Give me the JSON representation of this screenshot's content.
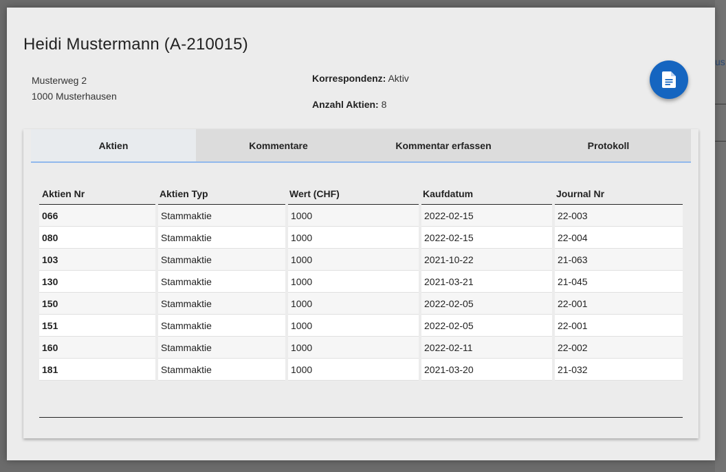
{
  "background": {
    "link_fragment": "us"
  },
  "dialog": {
    "title": "Heidi Mustermann (A-210015)",
    "address": {
      "street": "Musterweg 2",
      "city": "1000 Musterhausen"
    },
    "korrespondenz": {
      "label": "Korrespondenz:",
      "value": "Aktiv"
    },
    "anzahl_aktien": {
      "label": "Anzahl Aktien:",
      "value": "8"
    },
    "fab_icon": "document-icon",
    "accent_color": "#1565c0"
  },
  "tabs": [
    {
      "label": "Aktien",
      "active": true
    },
    {
      "label": "Kommentare",
      "active": false
    },
    {
      "label": "Kommentar erfassen",
      "active": false
    },
    {
      "label": "Protokoll",
      "active": false
    }
  ],
  "table": {
    "columns": [
      "Aktien Nr",
      "Aktien Typ",
      "Wert (CHF)",
      "Kaufdatum",
      "Journal Nr"
    ],
    "rows": [
      [
        "066",
        "Stammaktie",
        "1000",
        "2022-02-15",
        "22-003"
      ],
      [
        "080",
        "Stammaktie",
        "1000",
        "2022-02-15",
        "22-004"
      ],
      [
        "103",
        "Stammaktie",
        "1000",
        "2021-10-22",
        "21-063"
      ],
      [
        "130",
        "Stammaktie",
        "1000",
        "2021-03-21",
        "21-045"
      ],
      [
        "150",
        "Stammaktie",
        "1000",
        "2022-02-05",
        "22-001"
      ],
      [
        "151",
        "Stammaktie",
        "1000",
        "2022-02-05",
        "22-001"
      ],
      [
        "160",
        "Stammaktie",
        "1000",
        "2022-02-11",
        "22-002"
      ],
      [
        "181",
        "Stammaktie",
        "1000",
        "2021-03-20",
        "21-032"
      ]
    ]
  }
}
